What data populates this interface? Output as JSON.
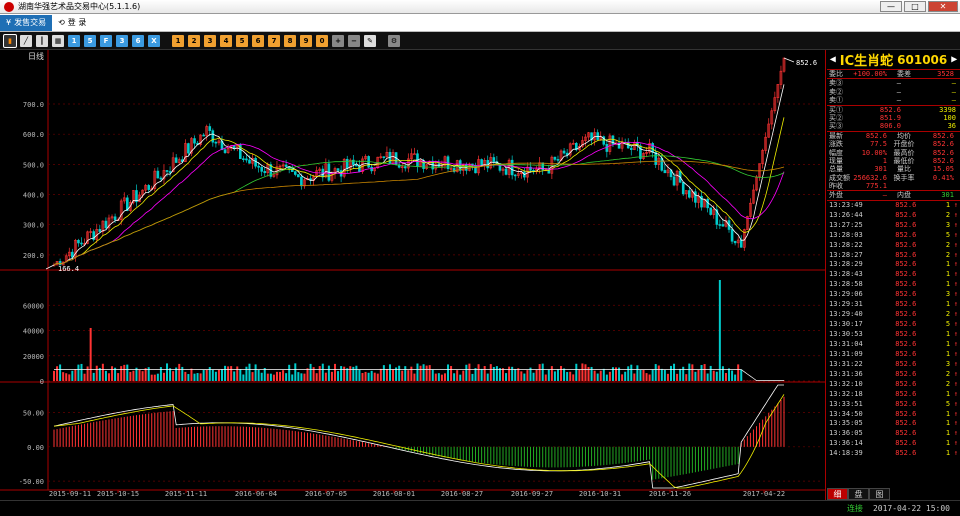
{
  "window": {
    "title": "湖南华强艺术品交易中心(5.1.1.6)"
  },
  "menu": {
    "items": [
      {
        "label": "发售交易",
        "icon": "¥"
      },
      {
        "label": "登    录",
        "icon": "⟲"
      }
    ]
  },
  "chart": {
    "period_label": "日线",
    "high_label": "852.6",
    "low_label": "166.4",
    "price_ticks": [
      "700.0",
      "600.0",
      "500.0",
      "400.0",
      "300.0",
      "200.0"
    ],
    "volume_ticks": [
      "60000",
      "40000",
      "20000",
      "0"
    ],
    "macd_ticks": [
      "50.00",
      "0.00",
      "-50.00"
    ],
    "date_ticks": [
      "2015-09-11",
      "2015-10-15",
      "2015-11-11",
      "2016-06-04",
      "2016-07-05",
      "2016-08-01",
      "2016-08-27",
      "2016-09-27",
      "2016-10-31",
      "2016-11-26",
      "2017-04-22"
    ]
  },
  "chart_data": {
    "type": "line",
    "title": "",
    "period": "日线",
    "x_dates": [
      "2015-09-11",
      "2015-10-15",
      "2015-11-11",
      "2016-06-04",
      "2016-07-05",
      "2016-08-01",
      "2016-08-27",
      "2016-09-27",
      "2016-10-31",
      "2016-11-26",
      "2017-04-22"
    ],
    "price_series": {
      "name": "",
      "values": [
        166.4,
        420,
        610,
        500,
        455,
        520,
        500,
        480,
        580,
        540,
        240,
        852.6
      ]
    },
    "price_ylim": [
      166.4,
      852.6
    ],
    "volume_ylim": [
      0,
      80000
    ],
    "macd_ylim": [
      -60,
      90
    ],
    "volume_spike_approx": 82000
  },
  "quote": {
    "name": "IC生肖蛇",
    "code": "601006",
    "weibi": {
      "label": "委比",
      "value": "+100.00%",
      "label2": "委差",
      "value2": "3528"
    },
    "sells": [
      {
        "label": "卖③",
        "price": "—",
        "vol": "—"
      },
      {
        "label": "卖②",
        "price": "—",
        "vol": "—"
      },
      {
        "label": "卖①",
        "price": "—",
        "vol": "—"
      }
    ],
    "buys": [
      {
        "label": "买①",
        "price": "852.6",
        "vol": "3398"
      },
      {
        "label": "买②",
        "price": "851.9",
        "vol": "100"
      },
      {
        "label": "买③",
        "price": "806.0",
        "vol": "36"
      }
    ],
    "stats": [
      {
        "l1": "最新",
        "v1": "852.6",
        "l2": "均价",
        "v2": "852.6"
      },
      {
        "l1": "涨跌",
        "v1": "77.5",
        "l2": "开盘价",
        "v2": "852.6"
      },
      {
        "l1": "幅度",
        "v1": "10.00%",
        "l2": "最高价",
        "v2": "852.6"
      },
      {
        "l1": "现量",
        "v1": "1",
        "l2": "最低价",
        "v2": "852.6"
      },
      {
        "l1": "总量",
        "v1": "301",
        "l2": "量比",
        "v2": "15.05"
      },
      {
        "l1": "成交额",
        "v1": "256632.6",
        "l2": "换手率",
        "v2": "0.41%"
      },
      {
        "l1": "昨收",
        "v1": "775.1",
        "l2": "",
        "v2": ""
      }
    ],
    "waipan": {
      "l1": "外盘",
      "v1": "—",
      "l2": "内盘",
      "v2": "301"
    },
    "ticks": [
      {
        "time": "13:23:49",
        "price": "852.6",
        "vol": "1",
        "dir": "↑"
      },
      {
        "time": "13:26:44",
        "price": "852.6",
        "vol": "2",
        "dir": "↑"
      },
      {
        "time": "13:27:25",
        "price": "852.6",
        "vol": "3",
        "dir": "↑"
      },
      {
        "time": "13:28:03",
        "price": "852.6",
        "vol": "5",
        "dir": "↑"
      },
      {
        "time": "13:28:22",
        "price": "852.6",
        "vol": "2",
        "dir": "↑"
      },
      {
        "time": "13:28:27",
        "price": "852.6",
        "vol": "2",
        "dir": "↑"
      },
      {
        "time": "13:28:29",
        "price": "852.6",
        "vol": "1",
        "dir": "↑"
      },
      {
        "time": "13:28:43",
        "price": "852.6",
        "vol": "1",
        "dir": "↑"
      },
      {
        "time": "13:28:58",
        "price": "852.6",
        "vol": "1",
        "dir": "↑"
      },
      {
        "time": "13:29:06",
        "price": "852.6",
        "vol": "3",
        "dir": "↑"
      },
      {
        "time": "13:29:31",
        "price": "852.6",
        "vol": "1",
        "dir": "↑"
      },
      {
        "time": "13:29:40",
        "price": "852.6",
        "vol": "2",
        "dir": "↑"
      },
      {
        "time": "13:30:17",
        "price": "852.6",
        "vol": "5",
        "dir": "↑"
      },
      {
        "time": "13:30:53",
        "price": "852.6",
        "vol": "1",
        "dir": "↑"
      },
      {
        "time": "13:31:04",
        "price": "852.6",
        "vol": "1",
        "dir": "↑"
      },
      {
        "time": "13:31:09",
        "price": "852.6",
        "vol": "1",
        "dir": "↑"
      },
      {
        "time": "13:31:22",
        "price": "852.6",
        "vol": "3",
        "dir": "↑"
      },
      {
        "time": "13:31:36",
        "price": "852.6",
        "vol": "2",
        "dir": "↑"
      },
      {
        "time": "13:32:10",
        "price": "852.6",
        "vol": "2",
        "dir": "↑"
      },
      {
        "time": "13:32:18",
        "price": "852.6",
        "vol": "1",
        "dir": "↑"
      },
      {
        "time": "13:33:51",
        "price": "852.6",
        "vol": "5",
        "dir": "↑"
      },
      {
        "time": "13:34:50",
        "price": "852.6",
        "vol": "1",
        "dir": "↑"
      },
      {
        "time": "13:35:05",
        "price": "852.6",
        "vol": "1",
        "dir": "↑"
      },
      {
        "time": "13:36:05",
        "price": "852.6",
        "vol": "1",
        "dir": "↑"
      },
      {
        "time": "13:36:14",
        "price": "852.6",
        "vol": "1",
        "dir": "↑"
      },
      {
        "time": "14:18:39",
        "price": "852.6",
        "vol": "1",
        "dir": "↑"
      }
    ],
    "tabs": [
      "细",
      "盘",
      "图"
    ]
  },
  "status": {
    "connection": "连接",
    "datetime": "2017-04-22 15:00"
  },
  "colors": {
    "up": "#ff3333",
    "down": "#00cccc",
    "accent": "#1f6fb5",
    "gold": "#ffd700"
  }
}
